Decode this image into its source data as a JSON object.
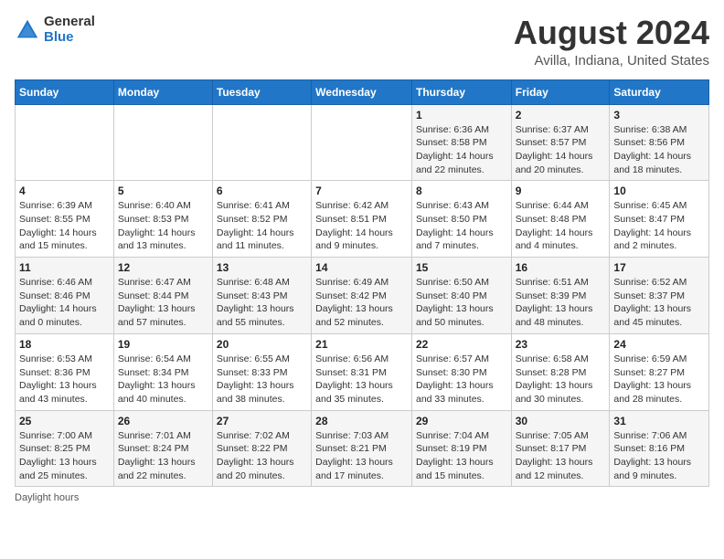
{
  "logo": {
    "general": "General",
    "blue": "Blue"
  },
  "title": "August 2024",
  "subtitle": "Avilla, Indiana, United States",
  "days_of_week": [
    "Sunday",
    "Monday",
    "Tuesday",
    "Wednesday",
    "Thursday",
    "Friday",
    "Saturday"
  ],
  "weeks": [
    [
      {
        "day": "",
        "info": ""
      },
      {
        "day": "",
        "info": ""
      },
      {
        "day": "",
        "info": ""
      },
      {
        "day": "",
        "info": ""
      },
      {
        "day": "1",
        "info": "Sunrise: 6:36 AM\nSunset: 8:58 PM\nDaylight: 14 hours\nand 22 minutes."
      },
      {
        "day": "2",
        "info": "Sunrise: 6:37 AM\nSunset: 8:57 PM\nDaylight: 14 hours\nand 20 minutes."
      },
      {
        "day": "3",
        "info": "Sunrise: 6:38 AM\nSunset: 8:56 PM\nDaylight: 14 hours\nand 18 minutes."
      }
    ],
    [
      {
        "day": "4",
        "info": "Sunrise: 6:39 AM\nSunset: 8:55 PM\nDaylight: 14 hours\nand 15 minutes."
      },
      {
        "day": "5",
        "info": "Sunrise: 6:40 AM\nSunset: 8:53 PM\nDaylight: 14 hours\nand 13 minutes."
      },
      {
        "day": "6",
        "info": "Sunrise: 6:41 AM\nSunset: 8:52 PM\nDaylight: 14 hours\nand 11 minutes."
      },
      {
        "day": "7",
        "info": "Sunrise: 6:42 AM\nSunset: 8:51 PM\nDaylight: 14 hours\nand 9 minutes."
      },
      {
        "day": "8",
        "info": "Sunrise: 6:43 AM\nSunset: 8:50 PM\nDaylight: 14 hours\nand 7 minutes."
      },
      {
        "day": "9",
        "info": "Sunrise: 6:44 AM\nSunset: 8:48 PM\nDaylight: 14 hours\nand 4 minutes."
      },
      {
        "day": "10",
        "info": "Sunrise: 6:45 AM\nSunset: 8:47 PM\nDaylight: 14 hours\nand 2 minutes."
      }
    ],
    [
      {
        "day": "11",
        "info": "Sunrise: 6:46 AM\nSunset: 8:46 PM\nDaylight: 14 hours\nand 0 minutes."
      },
      {
        "day": "12",
        "info": "Sunrise: 6:47 AM\nSunset: 8:44 PM\nDaylight: 13 hours\nand 57 minutes."
      },
      {
        "day": "13",
        "info": "Sunrise: 6:48 AM\nSunset: 8:43 PM\nDaylight: 13 hours\nand 55 minutes."
      },
      {
        "day": "14",
        "info": "Sunrise: 6:49 AM\nSunset: 8:42 PM\nDaylight: 13 hours\nand 52 minutes."
      },
      {
        "day": "15",
        "info": "Sunrise: 6:50 AM\nSunset: 8:40 PM\nDaylight: 13 hours\nand 50 minutes."
      },
      {
        "day": "16",
        "info": "Sunrise: 6:51 AM\nSunset: 8:39 PM\nDaylight: 13 hours\nand 48 minutes."
      },
      {
        "day": "17",
        "info": "Sunrise: 6:52 AM\nSunset: 8:37 PM\nDaylight: 13 hours\nand 45 minutes."
      }
    ],
    [
      {
        "day": "18",
        "info": "Sunrise: 6:53 AM\nSunset: 8:36 PM\nDaylight: 13 hours\nand 43 minutes."
      },
      {
        "day": "19",
        "info": "Sunrise: 6:54 AM\nSunset: 8:34 PM\nDaylight: 13 hours\nand 40 minutes."
      },
      {
        "day": "20",
        "info": "Sunrise: 6:55 AM\nSunset: 8:33 PM\nDaylight: 13 hours\nand 38 minutes."
      },
      {
        "day": "21",
        "info": "Sunrise: 6:56 AM\nSunset: 8:31 PM\nDaylight: 13 hours\nand 35 minutes."
      },
      {
        "day": "22",
        "info": "Sunrise: 6:57 AM\nSunset: 8:30 PM\nDaylight: 13 hours\nand 33 minutes."
      },
      {
        "day": "23",
        "info": "Sunrise: 6:58 AM\nSunset: 8:28 PM\nDaylight: 13 hours\nand 30 minutes."
      },
      {
        "day": "24",
        "info": "Sunrise: 6:59 AM\nSunset: 8:27 PM\nDaylight: 13 hours\nand 28 minutes."
      }
    ],
    [
      {
        "day": "25",
        "info": "Sunrise: 7:00 AM\nSunset: 8:25 PM\nDaylight: 13 hours\nand 25 minutes."
      },
      {
        "day": "26",
        "info": "Sunrise: 7:01 AM\nSunset: 8:24 PM\nDaylight: 13 hours\nand 22 minutes."
      },
      {
        "day": "27",
        "info": "Sunrise: 7:02 AM\nSunset: 8:22 PM\nDaylight: 13 hours\nand 20 minutes."
      },
      {
        "day": "28",
        "info": "Sunrise: 7:03 AM\nSunset: 8:21 PM\nDaylight: 13 hours\nand 17 minutes."
      },
      {
        "day": "29",
        "info": "Sunrise: 7:04 AM\nSunset: 8:19 PM\nDaylight: 13 hours\nand 15 minutes."
      },
      {
        "day": "30",
        "info": "Sunrise: 7:05 AM\nSunset: 8:17 PM\nDaylight: 13 hours\nand 12 minutes."
      },
      {
        "day": "31",
        "info": "Sunrise: 7:06 AM\nSunset: 8:16 PM\nDaylight: 13 hours\nand 9 minutes."
      }
    ]
  ],
  "footer": "Daylight hours"
}
